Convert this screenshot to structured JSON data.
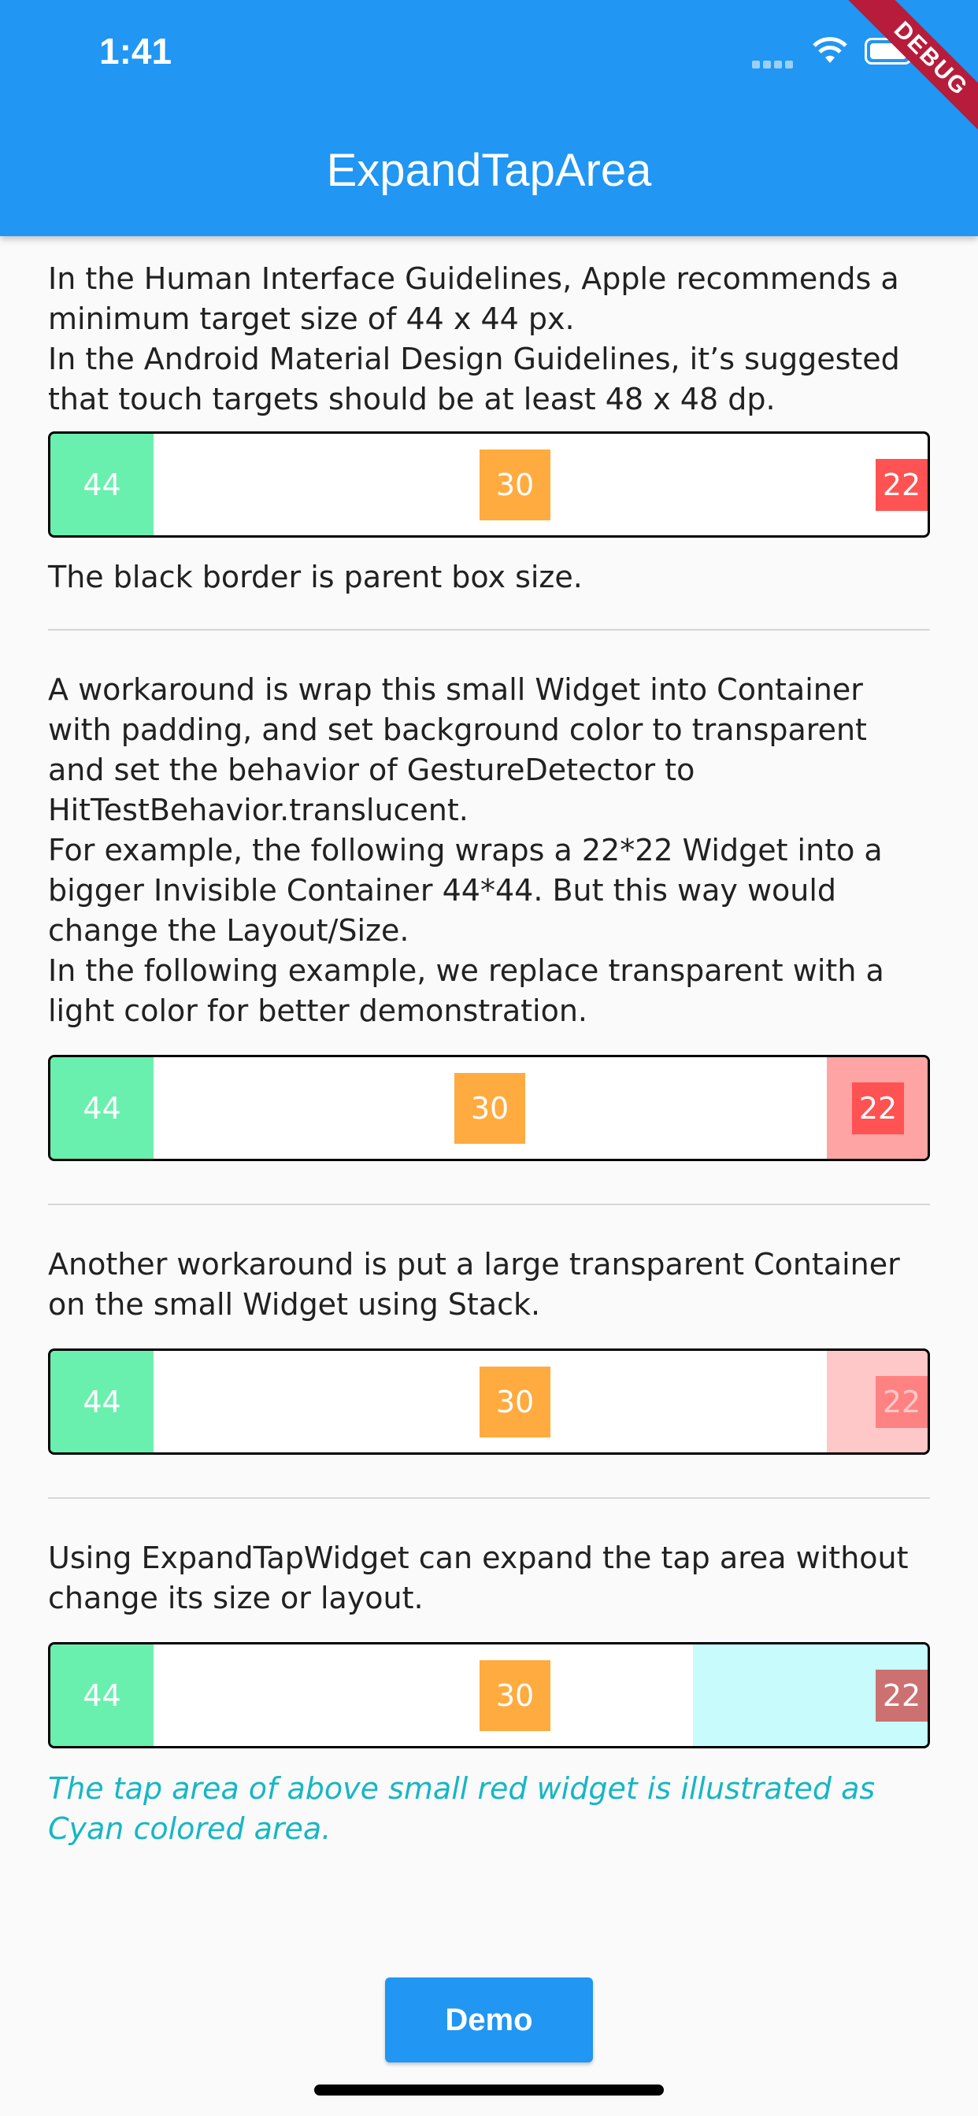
{
  "status_bar": {
    "time": "1:41"
  },
  "debug_banner": "DEBUG",
  "app_bar": {
    "title": "ExpandTapArea"
  },
  "sections": [
    {
      "text": "In the Human Interface Guidelines, Apple recommends a minimum target size of 44 x 44 px.\nIn the Android Material Design Guidelines, it’s suggested that touch targets should be at least 48 x 48 dp.",
      "labels": {
        "green": "44",
        "orange": "30",
        "red": "22"
      },
      "note": "The black border is parent box size."
    },
    {
      "text": "A workaround is wrap this small Widget into Container with padding, and set background color to transparent and set the behavior of GestureDetector to HitTestBehavior.translucent.\nFor example, the following wraps a 22*22 Widget into a bigger Invisible Container 44*44. But this way would change the Layout/Size.\nIn the following example, we replace transparent with a light color for better demonstration.",
      "labels": {
        "green": "44",
        "orange": "30",
        "red": "22"
      }
    },
    {
      "text": "Another workaround is put a large transparent Container on the small Widget using Stack.",
      "labels": {
        "green": "44",
        "orange": "30",
        "red": "22"
      }
    },
    {
      "text": "Using ExpandTapWidget can expand the tap area without change its size or layout.",
      "labels": {
        "green": "44",
        "orange": "30",
        "red": "22"
      },
      "note": "The tap area of above small red widget is illustrated as Cyan colored area."
    }
  ],
  "demo_button": "Demo",
  "colors": {
    "app_bar": "#2196f3",
    "green": "#69f0ae",
    "orange": "#ffab40",
    "red": "#ff5252",
    "pink_overlay": "#ffa4a4",
    "cyan_overlay": "#c8fcfc",
    "note_cyan": "#17b6c4"
  }
}
